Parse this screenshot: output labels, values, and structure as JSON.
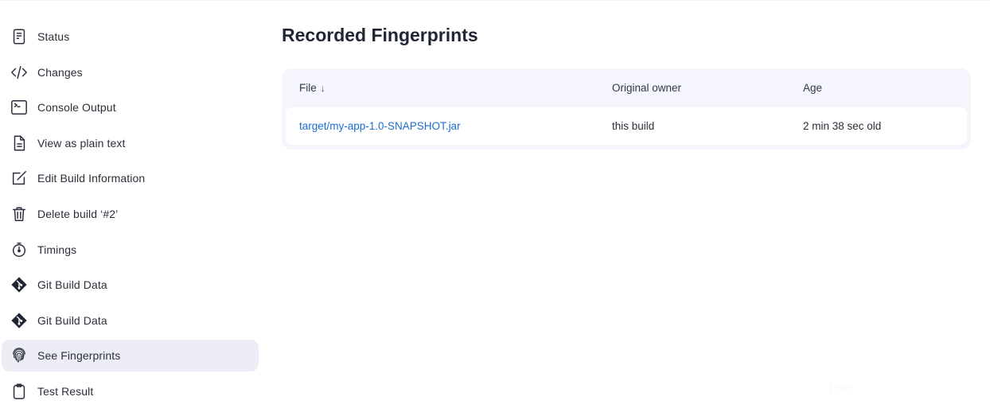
{
  "sidebar": {
    "items": [
      {
        "label": "Status",
        "icon": "status-document-icon",
        "active": false
      },
      {
        "label": "Changes",
        "icon": "code-icon",
        "active": false
      },
      {
        "label": "Console Output",
        "icon": "terminal-icon",
        "active": false
      },
      {
        "label": "View as plain text",
        "icon": "plain-text-file-icon",
        "active": false
      },
      {
        "label": "Edit Build Information",
        "icon": "edit-icon",
        "active": false
      },
      {
        "label": "Delete build ‘#2’",
        "icon": "trash-icon",
        "active": false
      },
      {
        "label": "Timings",
        "icon": "stopwatch-icon",
        "active": false
      },
      {
        "label": "Git Build Data",
        "icon": "git-icon",
        "active": false
      },
      {
        "label": "Git Build Data",
        "icon": "git-icon",
        "active": false
      },
      {
        "label": "See Fingerprints",
        "icon": "fingerprint-icon",
        "active": true
      },
      {
        "label": "Test Result",
        "icon": "clipboard-icon",
        "active": false
      }
    ]
  },
  "main": {
    "title": "Recorded Fingerprints",
    "table": {
      "columns": [
        {
          "label": "File",
          "sort_indicator": "↓"
        },
        {
          "label": "Original owner"
        },
        {
          "label": "Age"
        }
      ],
      "rows": [
        {
          "file": "target/my-app-1.0-SNAPSHOT.jar",
          "owner": "this build",
          "age": "2 min 38 sec old"
        }
      ]
    }
  },
  "ghost_text": "truc",
  "colors": {
    "link": "#1b6ed0",
    "active_bg": "#ededf5",
    "table_bg": "#f5f6fd"
  }
}
